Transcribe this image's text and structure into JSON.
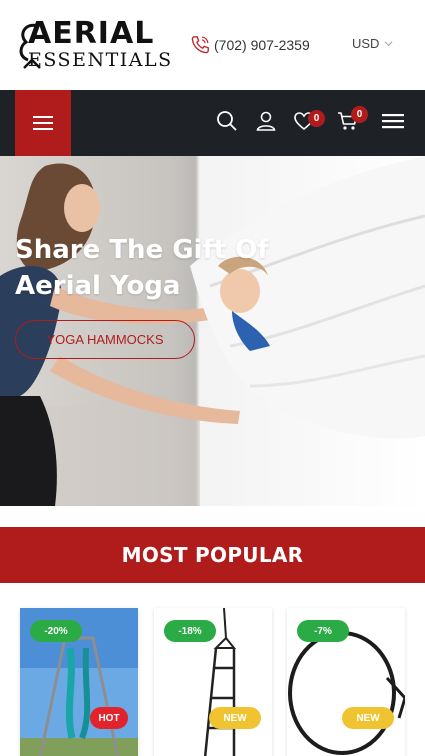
{
  "header": {
    "logo_line1": "AERIAL",
    "logo_line2": "ESSENTIALS",
    "phone": "(702) 907-2359",
    "currency": "USD"
  },
  "navbar": {
    "wishlist_count": "0",
    "cart_count": "0",
    "accent": "#b01c1c",
    "background": "#1e2226"
  },
  "hero": {
    "title": "Share The Gift Of Aerial Yoga",
    "button_label": "YOGA HAMMOCKS"
  },
  "section": {
    "title": "MOST POPULAR"
  },
  "products": [
    {
      "discount": "-20%",
      "tag": "HOT"
    },
    {
      "discount": "-18%",
      "tag": "NEW"
    },
    {
      "discount": "-7%",
      "tag": "NEW"
    }
  ]
}
